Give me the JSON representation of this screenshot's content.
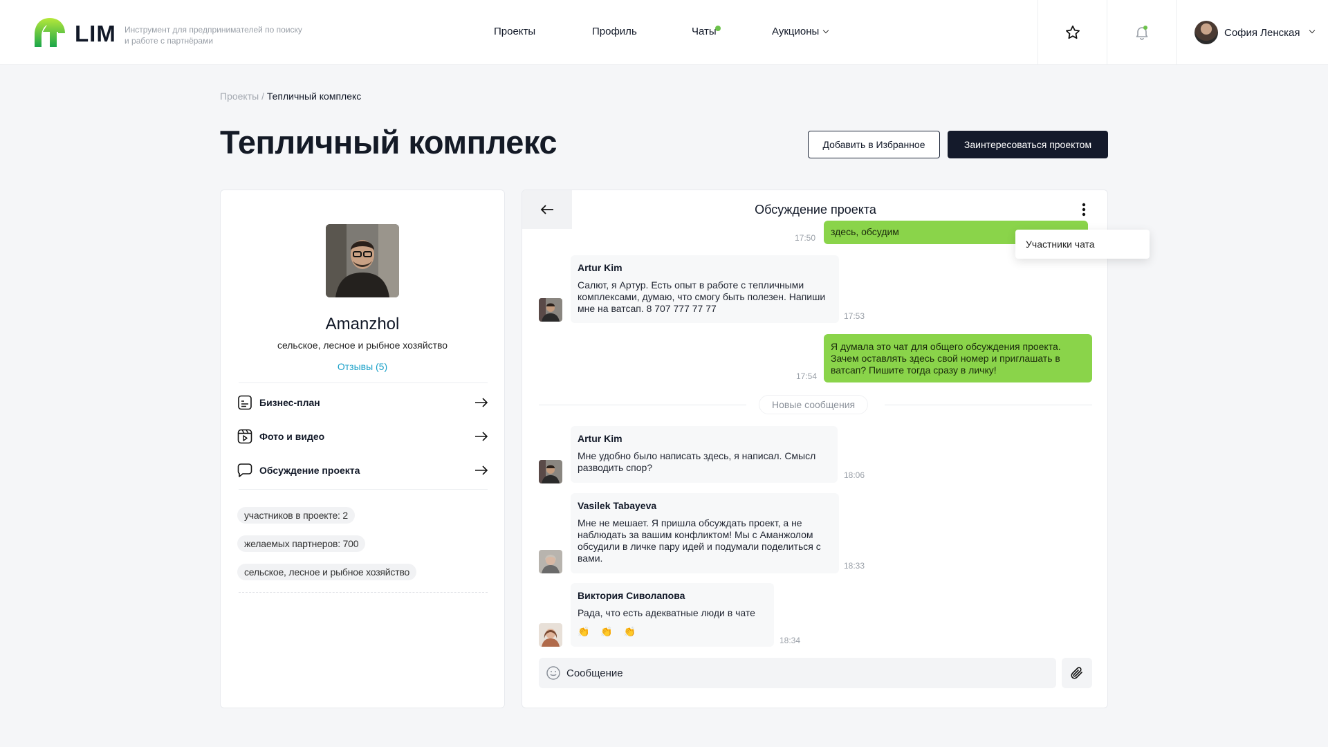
{
  "header": {
    "logo_text": "LIM",
    "tagline": "Инструмент для предпринимателей по поиску и работе с партнёрами",
    "nav": [
      {
        "label": "Проекты"
      },
      {
        "label": "Профиль"
      },
      {
        "label": "Чаты",
        "has_unread_dot": true
      },
      {
        "label": "Аукционы",
        "has_dropdown": true
      }
    ],
    "icons": [
      "star-icon",
      "bell-icon"
    ],
    "bell_has_dot": true,
    "user_name": "София Ленская"
  },
  "breadcrumb": {
    "parent": "Проекты",
    "separator": " / ",
    "current": "Тепличный комплекс"
  },
  "page_title": "Тепличный комплекс",
  "actions": {
    "favorite": "Добавить в Избранное",
    "interest": "Заинтересоваться проектом"
  },
  "profile": {
    "name": "Amanzhol",
    "industry": "сельское, лесное и рыбное хозяйство",
    "reviews": "Отзывы (5)",
    "menu": [
      {
        "label": "Бизнес-план",
        "icon": "document-icon"
      },
      {
        "label": "Фото и видео",
        "icon": "media-icon"
      },
      {
        "label": "Обсуждение проекта",
        "icon": "chat-bubble-icon"
      }
    ],
    "tags": [
      "участников в проекте: 2",
      "желаемых партнеров: 700",
      "сельское, лесное и рыбное хозяйство"
    ]
  },
  "chat": {
    "title": "Обсуждение проекта",
    "dropdown_item": "Участники чата",
    "new_messages_label": "Новые сообщения",
    "composer_placeholder": "Сообщение",
    "messages": [
      {
        "type": "out",
        "text": "здесь, обсудим",
        "time": "17:50"
      },
      {
        "type": "in",
        "author": "Artur Kim",
        "text": "Салют, я Артур. Есть опыт в работе с тепличными комплексами, думаю, что смогу быть полезен. Напиши мне на ватсап. 8 707 777 77 77",
        "time": "17:53"
      },
      {
        "type": "out",
        "text": "Я думала это чат для общего обсуждения проекта. Зачем оставлять здесь свой номер и приглашать в ватсап? Пишите тогда сразу в личку!",
        "time": "17:54"
      },
      {
        "type": "in",
        "author": "Artur Kim",
        "text": "Мне удобно было написать здесь, я написал. Смысл разводить спор?",
        "time": "18:06"
      },
      {
        "type": "in",
        "author": "Vasilek Tabayeva",
        "text": "Мне не мешает. Я пришла обсуждать проект, а не наблюдать за вашим конфликтом! Мы с Аманжолом обсудили в личке пару идей и подумали поделиться с вами.",
        "time": "18:33"
      },
      {
        "type": "in",
        "author": "Виктория Сиволапова",
        "text": "Рада, что есть адекватные люди в чате",
        "time": "18:34",
        "emojis": "👏 👏 👏"
      }
    ]
  },
  "colors": {
    "accent_green": "#8ad44a",
    "dark": "#141a2b",
    "link": "#1aa0c8"
  }
}
